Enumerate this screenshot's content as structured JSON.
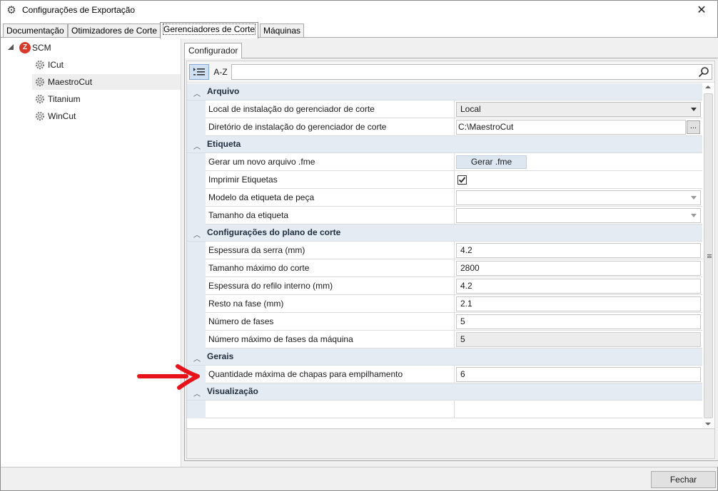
{
  "window": {
    "title": "Configurações de Exportação",
    "close_glyph": "✕",
    "app_icon": "gear-icon"
  },
  "tabs": [
    {
      "label": "Documentação"
    },
    {
      "label": "Otimizadores de Corte"
    },
    {
      "label": "Gerenciadores de Corte",
      "active": true
    },
    {
      "label": "Máquinas"
    }
  ],
  "tree": {
    "root": {
      "label": "SCM",
      "logo": "scm-logo-icon",
      "logo_glyph": "Z"
    },
    "children": [
      {
        "label": "ICut"
      },
      {
        "label": "MaestroCut",
        "selected": true
      },
      {
        "label": "Titanium"
      },
      {
        "label": "WinCut"
      }
    ]
  },
  "configurator": {
    "tab_label": "Configurador",
    "toolbar": {
      "sort_az_label": "A-Z",
      "search_placeholder": ""
    },
    "categories": {
      "arquivo": "Arquivo",
      "etiqueta": "Etiqueta",
      "plano": "Configurações do plano de corte",
      "gerais": "Gerais",
      "visualizacao": "Visualização"
    },
    "props": {
      "local_instalacao": {
        "name": "Local de instalação do gerenciador de corte",
        "value": "Local"
      },
      "diretorio_instalacao": {
        "name": "Diretório de instalação do gerenciador de corte",
        "value": "C:\\MaestroCut",
        "button": "..."
      },
      "gerar_fme": {
        "name": "Gerar um novo arquivo .fme",
        "button": "Gerar .fme"
      },
      "imprimir_etiquetas": {
        "name": "Imprimir Etiquetas",
        "checked": true
      },
      "modelo_etiqueta": {
        "name": "Modelo da etiqueta de peça",
        "value": ""
      },
      "tamanho_etiqueta": {
        "name": "Tamanho da etiqueta",
        "value": ""
      },
      "espessura_serra": {
        "name": "Espessura da serra (mm)",
        "value": "4.2"
      },
      "tamanho_maximo": {
        "name": "Tamanho máximo do corte",
        "value": "2800"
      },
      "espessura_refilo": {
        "name": "Espessura do refilo interno (mm)",
        "value": "4.2"
      },
      "resto_fase": {
        "name": "Resto na fase (mm)",
        "value": "2.1"
      },
      "numero_fases": {
        "name": "Número de fases",
        "value": "5"
      },
      "numero_max_fases": {
        "name": "Número máximo de fases da máquina",
        "value": "5"
      },
      "qtd_max_chapas": {
        "name": "Quantidade máxima de chapas para empilhamento",
        "value": "6"
      }
    }
  },
  "footer": {
    "close_button": "Fechar"
  },
  "annotation": {
    "arrow_color": "#e8121b"
  }
}
